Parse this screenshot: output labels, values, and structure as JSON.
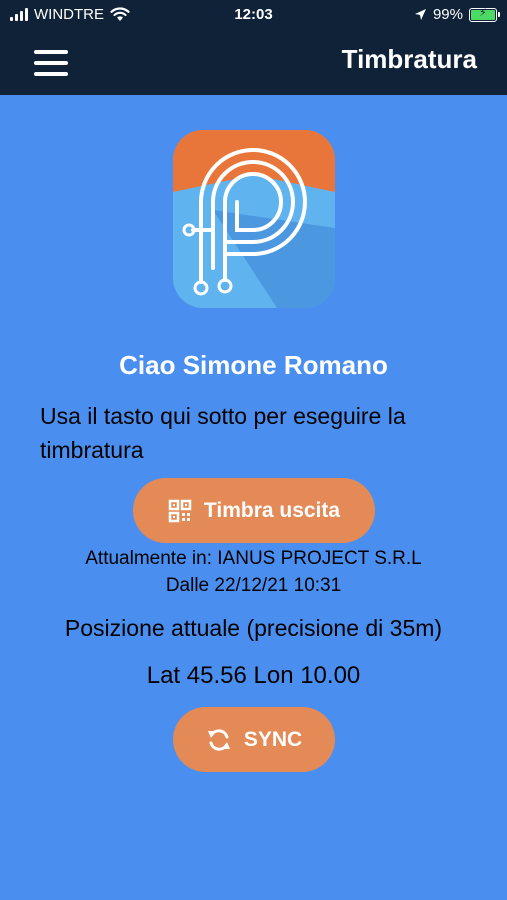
{
  "status_bar": {
    "carrier": "WINDTRE",
    "time": "12:03",
    "battery": "99%",
    "battery_level": 0.99,
    "icons": [
      "signal-icon",
      "wifi-icon",
      "location-arrow-icon",
      "battery-charging-icon"
    ]
  },
  "nav": {
    "title": "Timbratura",
    "menu_icon": "hamburger-menu-icon"
  },
  "colors": {
    "background": "#4a8ff0",
    "nav_bar": "#0f2237",
    "button": "#e38a57",
    "logo_top": "#e8763a",
    "logo_bottom": "#5fb3ee"
  },
  "main": {
    "greeting": "Ciao Simone Romano",
    "instructions": "Usa il tasto qui sotto per eseguire la timbratura",
    "timbra_button": {
      "label": "Timbra uscita",
      "icon": "qr-code-icon"
    },
    "current_location_line1": "Attualmente in: IANUS PROJECT S.R.L",
    "current_location_line2": "Dalle 22/12/21 10:31",
    "position_text": "Posizione attuale (precisione di 35m)",
    "coordinates": "Lat 45.56 Lon 10.00",
    "sync_button": {
      "label": "SYNC",
      "icon": "sync-icon"
    }
  }
}
